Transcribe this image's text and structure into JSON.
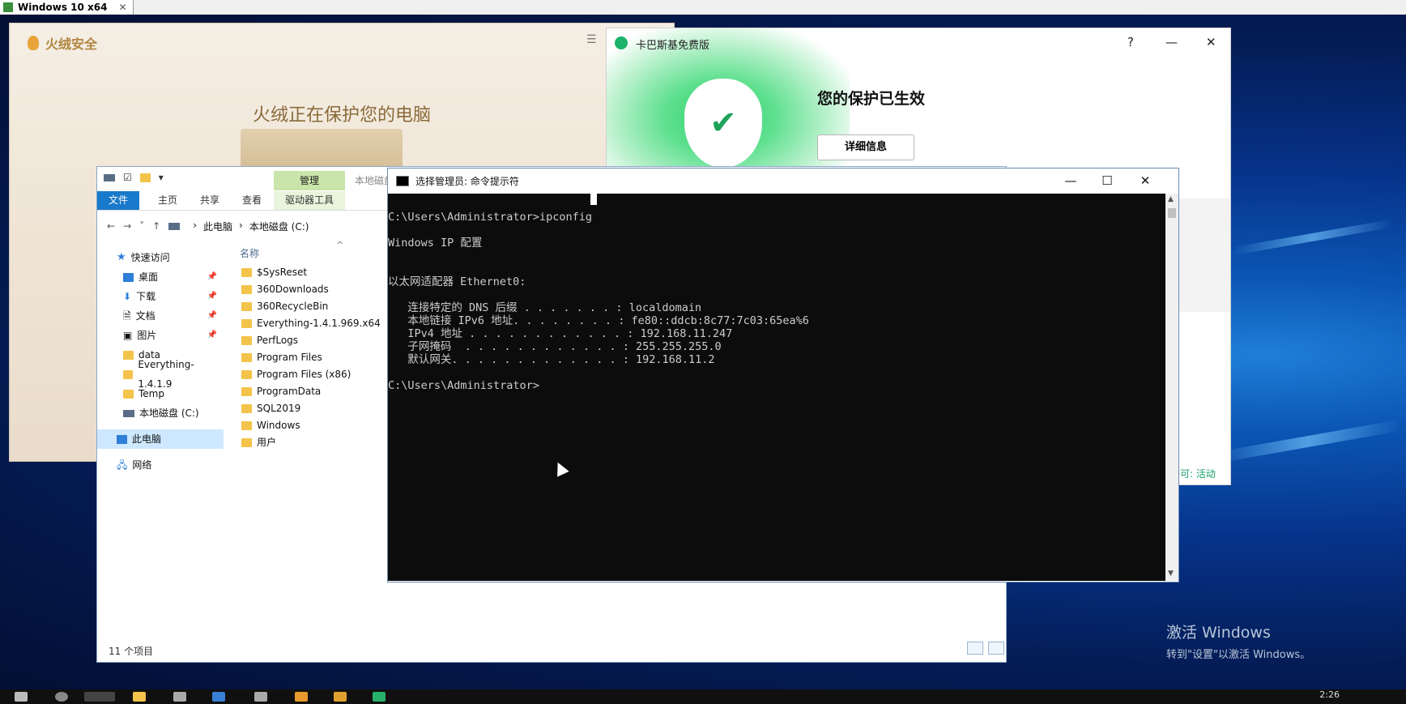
{
  "vm": {
    "tab_title": "Windows 10 x64",
    "close_glyph": "✕"
  },
  "huorong": {
    "app_name": "火绒安全",
    "status": "火绒正在保护您的电脑",
    "menu_icon": "list-icon"
  },
  "kaspersky": {
    "title": "卡巴斯基免费版",
    "headline": "您的保护已生效",
    "details_button": "详细信息",
    "help": "?",
    "minimize": "—",
    "close": "✕",
    "bottom_link": "许可: 活动"
  },
  "explorer": {
    "tabs": [
      "文件",
      "主页",
      "共享",
      "查看"
    ],
    "context_group": "管理",
    "context_tab": "驱动器工具",
    "context_title": "本地磁盘",
    "breadcrumb": [
      "此电脑",
      "本地磁盘 (C:)"
    ],
    "column_name": "名称",
    "nav": [
      {
        "label": "快速访问",
        "icon": "star"
      },
      {
        "label": "桌面",
        "icon": "desktop",
        "pinned": true
      },
      {
        "label": "下载",
        "icon": "download",
        "pinned": true
      },
      {
        "label": "文档",
        "icon": "document",
        "pinned": true
      },
      {
        "label": "图片",
        "icon": "pictures",
        "pinned": true
      },
      {
        "label": "data",
        "icon": "folder"
      },
      {
        "label": "Everything-1.4.1.9",
        "icon": "folder"
      },
      {
        "label": "Temp",
        "icon": "folder"
      },
      {
        "label": "本地磁盘 (C:)",
        "icon": "drive"
      },
      {
        "label": "此电脑",
        "icon": "pc",
        "selected": true
      },
      {
        "label": "网络",
        "icon": "network"
      }
    ],
    "files": [
      "$SysReset",
      "360Downloads",
      "360RecycleBin",
      "Everything-1.4.1.969.x64",
      "PerfLogs",
      "Program Files",
      "Program Files (x86)",
      "ProgramData",
      "SQL2019",
      "Windows",
      "用户"
    ],
    "status": "11 个项目"
  },
  "cmd": {
    "title": "选择管理员: 命令提示符",
    "lines": [
      "",
      "C:\\Users\\Administrator>ipconfig",
      "",
      "Windows IP 配置",
      "",
      "",
      "以太网适配器 Ethernet0:",
      "",
      "   连接特定的 DNS 后缀 . . . . . . . : localdomain",
      "   本地链接 IPv6 地址. . . . . . . . : fe80::ddcb:8c77:7c03:65ea%6",
      "   IPv4 地址 . . . . . . . . . . . . : 192.168.11.247",
      "   子网掩码  . . . . . . . . . . . . : 255.255.255.0",
      "   默认网关. . . . . . . . . . . . . : 192.168.11.2",
      "",
      "C:\\Users\\Administrator>"
    ]
  },
  "desktop": {
    "activate_title": "激活 Windows",
    "activate_sub": "转到\"设置\"以激活 Windows。"
  },
  "taskbar": {
    "clock": "2:26"
  },
  "colors": {
    "accent": "#1979ca",
    "huorong_text": "#8a6a3a",
    "kaspersky_green": "#1ea35a"
  }
}
